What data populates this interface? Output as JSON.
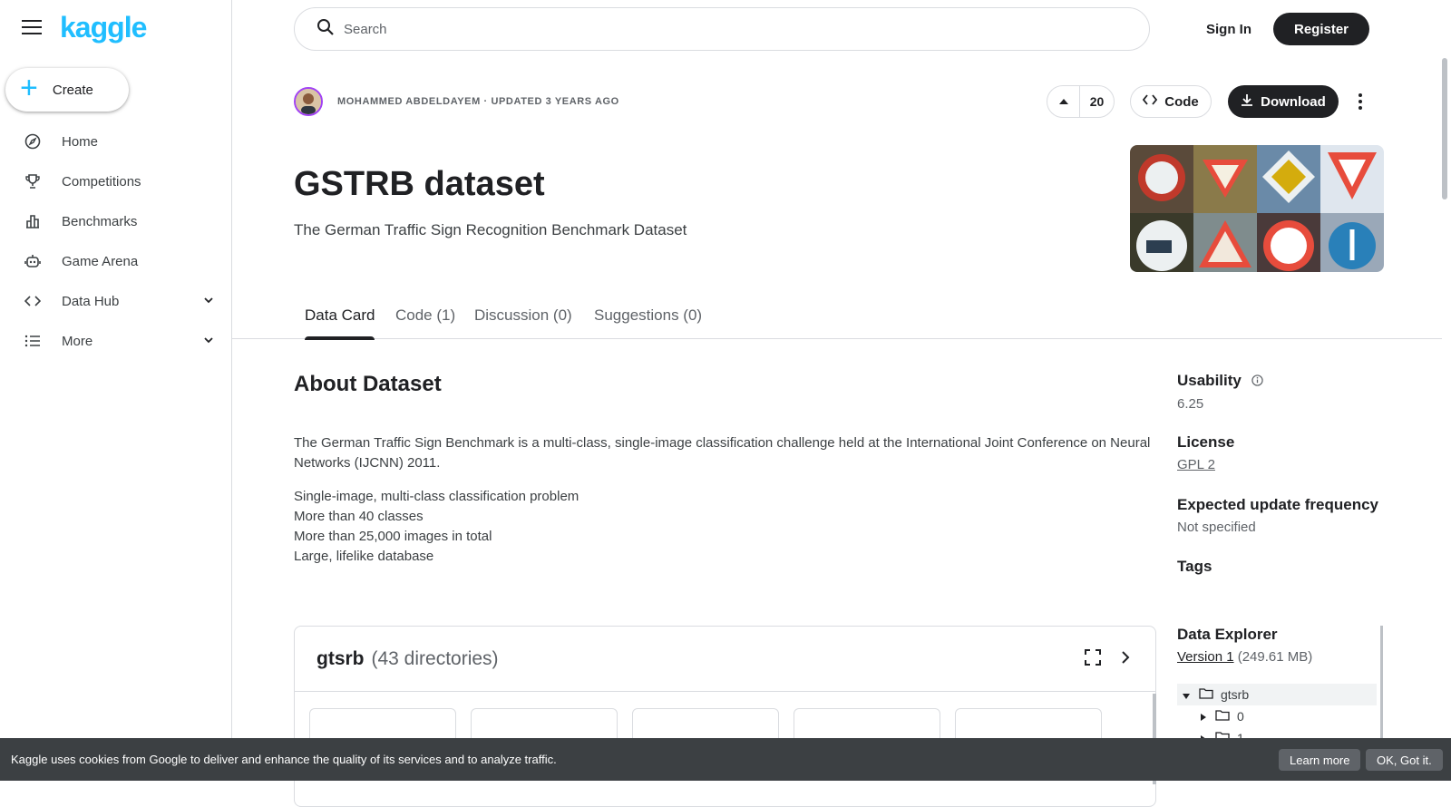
{
  "brand": {
    "logo": "kaggle",
    "accent": "#20beff"
  },
  "sidebar": {
    "create_label": "Create",
    "items": [
      {
        "label": "Home",
        "icon": "compass-icon"
      },
      {
        "label": "Competitions",
        "icon": "trophy-icon"
      },
      {
        "label": "Benchmarks",
        "icon": "bar-chart-icon"
      },
      {
        "label": "Game Arena",
        "icon": "robot-icon"
      },
      {
        "label": "Data Hub",
        "icon": "code-brackets-icon"
      },
      {
        "label": "More",
        "icon": "list-icon"
      }
    ]
  },
  "header": {
    "search_placeholder": "Search",
    "signin_label": "Sign In",
    "register_label": "Register"
  },
  "dataset": {
    "byline": "MOHAMMED ABDELDAYEM · UPDATED 3 YEARS AGO",
    "vote_count": "20",
    "code_label": "Code",
    "download_label": "Download",
    "title": "GSTRB dataset",
    "subtitle": "The German Traffic Sign Recognition Benchmark Dataset"
  },
  "tabs": [
    {
      "label": "Data Card"
    },
    {
      "label": "Code (1)"
    },
    {
      "label": "Discussion (0)"
    },
    {
      "label": "Suggestions (0)"
    }
  ],
  "about": {
    "heading": "About Dataset",
    "description": "The German Traffic Sign Benchmark is a multi-class, single-image classification challenge held at the International Joint Conference on Neural Networks (IJCNN) 2011.",
    "bullets": [
      "Single-image, multi-class classification problem",
      "More than 40 classes",
      "More than 25,000 images in total",
      "Large, lifelike database"
    ]
  },
  "meta": {
    "usability_label": "Usability",
    "usability_value": "6.25",
    "license_label": "License",
    "license_value": "GPL 2",
    "frequency_label": "Expected update frequency",
    "frequency_value": "Not specified",
    "tags_label": "Tags",
    "explorer_label": "Data Explorer",
    "version_label": "Version 1",
    "version_size": "(249.61 MB)"
  },
  "explorer": {
    "name": "gtsrb",
    "count": "(43 directories)"
  },
  "tree": [
    {
      "label": "gtsrb"
    },
    {
      "label": "0"
    },
    {
      "label": "1"
    }
  ],
  "cookie": {
    "text": "Kaggle uses cookies from Google to deliver and enhance the quality of its services and to analyze traffic.",
    "learn_more": "Learn more",
    "ok": "OK, Got it."
  }
}
